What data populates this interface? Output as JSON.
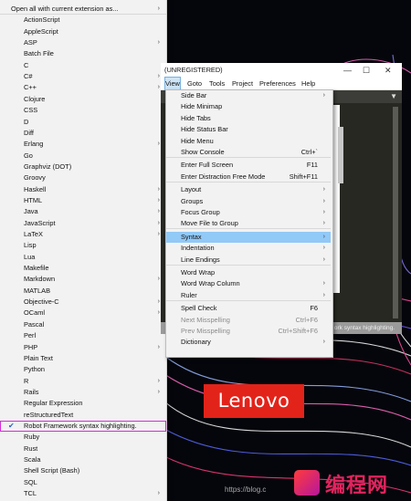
{
  "syntax_menu": {
    "items": [
      {
        "label": "Open all with current extension as...",
        "arrow": true,
        "sep": true
      },
      {
        "label": "ActionScript"
      },
      {
        "label": "AppleScript"
      },
      {
        "label": "ASP",
        "arrow": true
      },
      {
        "label": "Batch File"
      },
      {
        "label": "C"
      },
      {
        "label": "C#",
        "arrow": true
      },
      {
        "label": "C++",
        "arrow": true
      },
      {
        "label": "Clojure"
      },
      {
        "label": "CSS"
      },
      {
        "label": "D"
      },
      {
        "label": "Diff"
      },
      {
        "label": "Erlang",
        "arrow": true
      },
      {
        "label": "Go"
      },
      {
        "label": "Graphviz (DOT)"
      },
      {
        "label": "Groovy"
      },
      {
        "label": "Haskell",
        "arrow": true
      },
      {
        "label": "HTML",
        "arrow": true
      },
      {
        "label": "Java",
        "arrow": true
      },
      {
        "label": "JavaScript",
        "arrow": true
      },
      {
        "label": "LaTeX",
        "arrow": true
      },
      {
        "label": "Lisp"
      },
      {
        "label": "Lua"
      },
      {
        "label": "Makefile"
      },
      {
        "label": "Markdown",
        "arrow": true
      },
      {
        "label": "MATLAB"
      },
      {
        "label": "Objective-C",
        "arrow": true
      },
      {
        "label": "OCaml",
        "arrow": true
      },
      {
        "label": "Pascal"
      },
      {
        "label": "Perl"
      },
      {
        "label": "PHP",
        "arrow": true
      },
      {
        "label": "Plain Text"
      },
      {
        "label": "Python"
      },
      {
        "label": "R",
        "arrow": true
      },
      {
        "label": "Rails",
        "arrow": true
      },
      {
        "label": "Regular Expression"
      },
      {
        "label": "reStructuredText"
      },
      {
        "label": "Robot Framework syntax highlighting.",
        "checked": true,
        "highlight": true
      },
      {
        "label": "Ruby"
      },
      {
        "label": "Rust"
      },
      {
        "label": "Scala"
      },
      {
        "label": "Shell Script (Bash)"
      },
      {
        "label": "SQL"
      },
      {
        "label": "TCL",
        "arrow": true
      }
    ]
  },
  "editor": {
    "title": "(UNREGISTERED)",
    "menubar": [
      "View",
      "Goto",
      "Tools",
      "Project",
      "Preferences",
      "Help"
    ],
    "status_text": "ork syntax highlighting."
  },
  "view_menu": {
    "items": [
      {
        "label": "Side Bar",
        "arrow": true
      },
      {
        "label": "Hide Minimap"
      },
      {
        "label": "Hide Tabs"
      },
      {
        "label": "Hide Status Bar"
      },
      {
        "label": "Hide Menu"
      },
      {
        "label": "Show Console",
        "shortcut": "Ctrl+`",
        "sep": true
      },
      {
        "label": "Enter Full Screen",
        "shortcut": "F11"
      },
      {
        "label": "Enter Distraction Free Mode",
        "shortcut": "Shift+F11",
        "sep": true
      },
      {
        "label": "Layout",
        "arrow": true
      },
      {
        "label": "Groups",
        "arrow": true
      },
      {
        "label": "Focus Group",
        "arrow": true
      },
      {
        "label": "Move File to Group",
        "arrow": true,
        "sep": true
      },
      {
        "label": "Syntax",
        "arrow": true,
        "selected": true
      },
      {
        "label": "Indentation",
        "arrow": true
      },
      {
        "label": "Line Endings",
        "arrow": true,
        "sep": true
      },
      {
        "label": "Word Wrap"
      },
      {
        "label": "Word Wrap Column",
        "arrow": true
      },
      {
        "label": "Ruler",
        "arrow": true,
        "sep": true
      },
      {
        "label": "Spell Check",
        "shortcut": "F6"
      },
      {
        "label": "Next Misspelling",
        "shortcut": "Ctrl+F6",
        "disabled": true
      },
      {
        "label": "Prev Misspelling",
        "shortcut": "Ctrl+Shift+F6",
        "disabled": true
      },
      {
        "label": "Dictionary",
        "arrow": true
      }
    ]
  },
  "logo": {
    "text": "Lenovo"
  },
  "watermark": {
    "url": "https://blog.c",
    "text": "编程网"
  },
  "colors": {
    "accent_selected": "#91c9f7",
    "highlight_outline": "#d22cd6",
    "logo_red": "#e2231a"
  }
}
